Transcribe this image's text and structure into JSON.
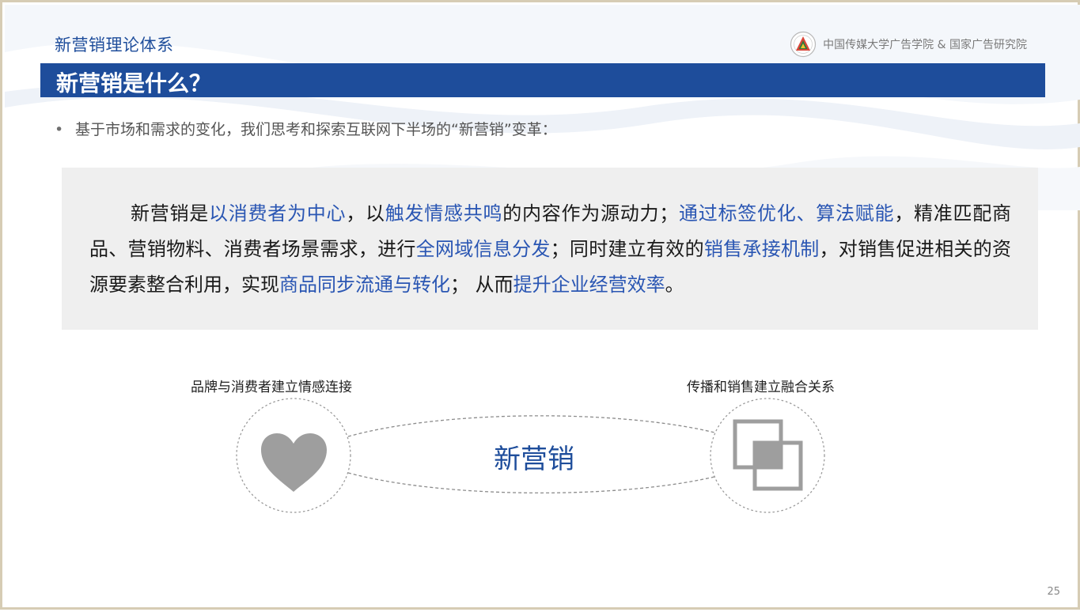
{
  "header": {
    "section_title": "新营销理论体系",
    "org_name": "中国传媒大学广告学院 & 国家广告研究院",
    "logo_icon": "university-emblem-icon"
  },
  "title_bar": {
    "title": "新营销是什么？",
    "color": "#1e4d9b"
  },
  "bullet": {
    "marker": "•",
    "text": "基于市场和需求的变化，我们思考和探索互联网下半场的“新营销”变革："
  },
  "definition": {
    "highlight_color": "#2a56b3",
    "segments": [
      {
        "text": "新营销是",
        "highlight": false
      },
      {
        "text": "以消费者为中心",
        "highlight": true
      },
      {
        "text": "，以",
        "highlight": false
      },
      {
        "text": "触发情感共鸣",
        "highlight": true
      },
      {
        "text": "的内容作为源动力；",
        "highlight": false
      },
      {
        "text": "通过标签优化、算法赋能",
        "highlight": true
      },
      {
        "text": "，精准匹配商品、营销物料、消费者场景需求，进行",
        "highlight": false
      },
      {
        "text": "全网域信息分发",
        "highlight": true
      },
      {
        "text": "；同时建立有效的",
        "highlight": false
      },
      {
        "text": "销售承接机制",
        "highlight": true
      },
      {
        "text": "，对销售促进相关的资源要素整合利用，实现",
        "highlight": false
      },
      {
        "text": "商品同步流通与转化",
        "highlight": true
      },
      {
        "text": "； 从而",
        "highlight": false
      },
      {
        "text": "提升企业经营效率",
        "highlight": true
      },
      {
        "text": "。",
        "highlight": false
      }
    ]
  },
  "diagram": {
    "left_caption": "品牌与消费者建立情感连接",
    "right_caption": "传播和销售建立融合关系",
    "center_label": "新营销",
    "left_icon": "heart-icon",
    "right_icon": "overlapping-squares-icon",
    "icon_color": "#9e9e9e"
  },
  "footer": {
    "page_number": "25"
  }
}
